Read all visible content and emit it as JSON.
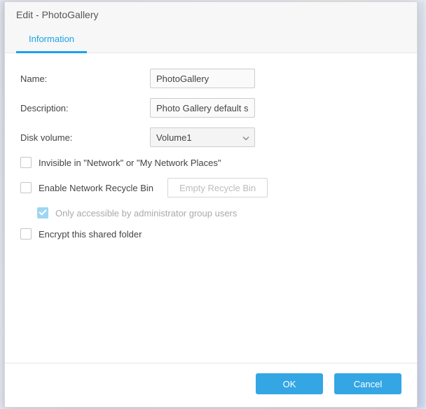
{
  "dialog": {
    "title": "Edit - PhotoGallery",
    "tabs": [
      {
        "label": "Information"
      }
    ]
  },
  "form": {
    "name_label": "Name:",
    "name_value": "PhotoGallery",
    "description_label": "Description:",
    "description_value": "Photo Gallery default sh",
    "disk_volume_label": "Disk volume:",
    "disk_volume_value": "Volume1",
    "invisible_label": "Invisible in \"Network\" or \"My Network Places\"",
    "recycle_label": "Enable Network Recycle Bin",
    "empty_recycle_btn": "Empty Recycle Bin",
    "admin_only_label": "Only accessible by administrator group users",
    "encrypt_label": "Encrypt this shared folder"
  },
  "footer": {
    "ok": "OK",
    "cancel": "Cancel"
  }
}
